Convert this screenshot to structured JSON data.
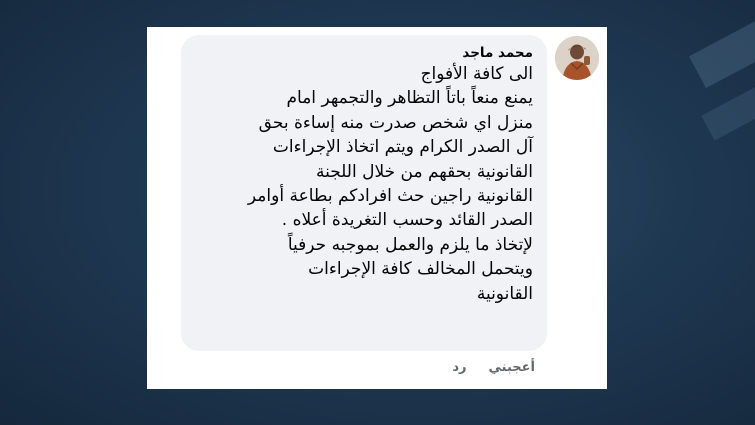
{
  "comment": {
    "author": "محمد ماجد",
    "lines": [
      "الى كافة الأفواج",
      "يمنع منعاً باتاً التظاهر والتجمهر امام",
      "منزل اي شخص صدرت منه إساءة بحق",
      "آل الصدر الكرام ويتم اتخاذ الإجراءات",
      "القانونية بحقهم من خلال اللجنة",
      "القانونية راجين حث افرادكم بطاعة أوامر",
      "الصدر القائد وحسب التغريدة أعلاه .",
      "لإتخاذ ما يلزم والعمل بموجبه حرفياً",
      "ويتحمل المخالف كافة الإجراءات",
      "القانونية"
    ]
  },
  "actions": {
    "like_label": "أعجبني",
    "reply_label": "رد"
  }
}
